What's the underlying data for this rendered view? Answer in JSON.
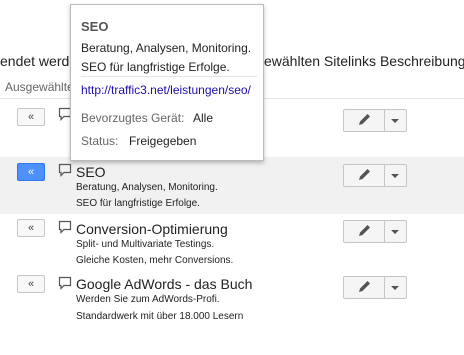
{
  "headline": {
    "left": "endet werde",
    "right": "ewählten Sitelinks Beschreibungen"
  },
  "column_header": "Ausgewählte",
  "popup": {
    "title": "SEO",
    "line1": "Beratung, Analysen, Monitoring.",
    "line2": "SEO für langfristige Erfolge.",
    "url": "http://traffic3.net/leistungen/seo/",
    "device_label": "Bevorzugtes Gerät:",
    "device_value": "Alle",
    "status_label": "Status:",
    "status_value": "Freigegeben"
  },
  "rows": [
    {
      "arrow": "«",
      "title": "",
      "line1": "",
      "line2": ""
    },
    {
      "arrow": "«",
      "title": "SEO",
      "line1": "Beratung, Analysen, Monitoring.",
      "line2": "SEO für langfristige Erfolge."
    },
    {
      "arrow": "«",
      "title": "Conversion-Optimierung",
      "line1": "Split- und Multivariate Testings.",
      "line2": "Gleiche Kosten, mehr Conversions."
    },
    {
      "arrow": "«",
      "title": "Google AdWords - das Buch",
      "line1": "Werden Sie zum AdWords-Profi.",
      "line2": "Standardwerk mit über 18.000 Lesern"
    }
  ],
  "colors": {
    "active_button": "#4d90fe",
    "link": "#1a0dab",
    "selected_row": "#f1f1f1"
  },
  "icons": [
    "comment-icon",
    "pencil-icon",
    "chevron-down-icon"
  ]
}
